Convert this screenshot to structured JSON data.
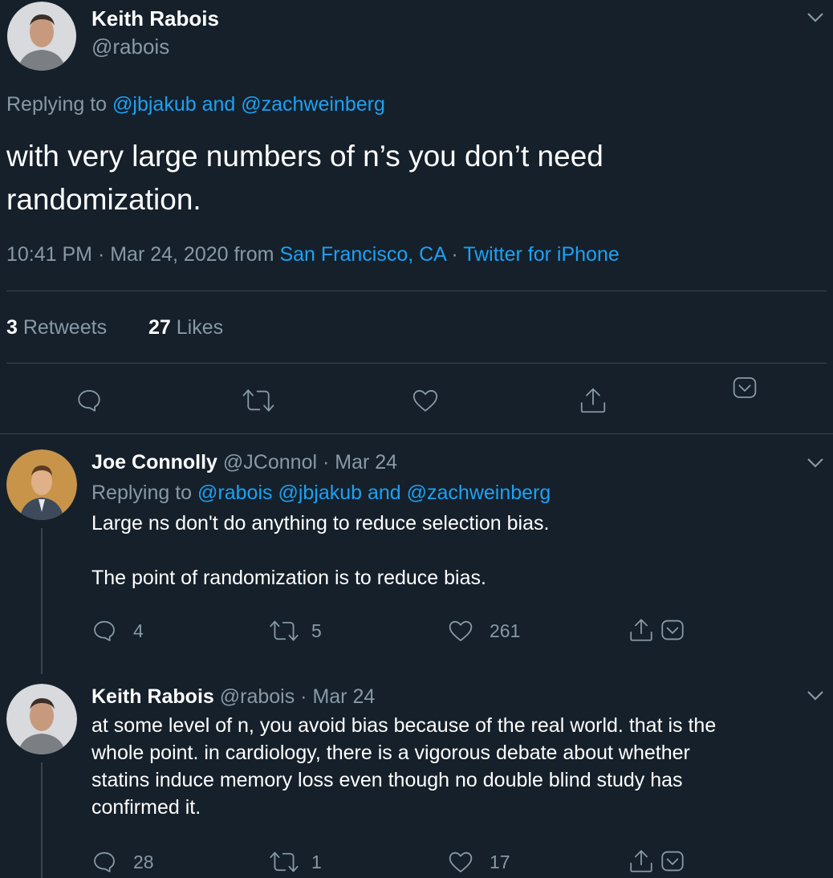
{
  "main_tweet": {
    "author_name": "Keith Rabois",
    "author_handle": "@rabois",
    "replying_prefix": "Replying to ",
    "replying_to": "@jbjakub and @zachweinberg",
    "text_line1": "with very large numbers of n’s you don’t need",
    "text_line2": "randomization.",
    "time_date": "10:41 PM · Mar 24, 2020 from ",
    "location": "San Francisco, CA",
    "separator": " · ",
    "source": "Twitter for iPhone",
    "retweets_count": "3",
    "retweets_label": " Retweets",
    "likes_count": "27",
    "likes_label": " Likes"
  },
  "reply1": {
    "author_name": "Joe Connolly",
    "author_handle": "@JConnol",
    "date": " · Mar 24",
    "replying_prefix": "Replying to ",
    "replying_to": "@rabois @jbjakub and @zachweinberg",
    "text_line1": "Large ns don't do anything to reduce selection bias.",
    "text_line2": "The point of randomization is to reduce bias.",
    "replies": "4",
    "retweets": "5",
    "likes": "261"
  },
  "reply2": {
    "author_name": "Keith Rabois",
    "author_handle": "@rabois",
    "date": " · Mar 24",
    "text_line1": "at some level of n, you avoid bias because of the real world.  that is the",
    "text_line2": "whole point.  in cardiology, there is a vigorous debate about whether",
    "text_line3": "statins induce memory loss even though no double blind study has",
    "text_line4": "confirmed it.",
    "replies": "28",
    "retweets": "1",
    "likes": "17"
  },
  "colors": {
    "background": "#15202b",
    "text": "#ffffff",
    "muted": "#8899a6",
    "link": "#1da1f2",
    "divider": "#38444d"
  },
  "icons": [
    "chevron-down-icon",
    "reply-icon",
    "retweet-icon",
    "like-icon",
    "share-icon",
    "bookmark-icon"
  ]
}
